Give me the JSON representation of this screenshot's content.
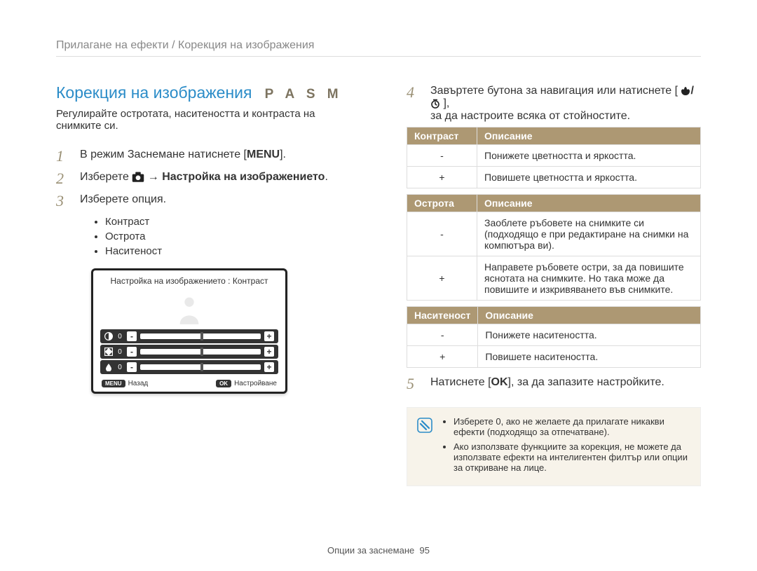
{
  "breadcrumb": "Прилагане на ефекти / Корекция на изображения",
  "title": "Корекция на изображения",
  "modes": "P A S M",
  "intro": "Регулирайте остротата, наситеността и контраста на снимките си.",
  "steps": {
    "s1_prefix": "В режим Заснемане натиснете [",
    "s1_key": "MENU",
    "s1_suffix": "].",
    "s2_prefix": "Изберете ",
    "s2_arrow": " → ",
    "s2_bold": "Настройка на изображението",
    "s2_suffix": ".",
    "s3": "Изберете опция.",
    "s4_a": "Завъртете бутона за навигация или натиснете [",
    "s4_b": "],",
    "s4_c": "за да настроите всяка от стойностите.",
    "s5_a": "Натиснете [",
    "s5_key": "OK",
    "s5_b": "], за да запазите настройките."
  },
  "bullets": [
    "Контраст",
    "Острота",
    "Наситеност"
  ],
  "lcd": {
    "title": "Настройка на изображението : Контраст",
    "back_key": "MENU",
    "back_label": "Назад",
    "set_key": "OK",
    "set_label": "Настройване",
    "rows": [
      {
        "val": "0"
      },
      {
        "val": "0"
      },
      {
        "val": "0"
      }
    ]
  },
  "tables": {
    "contrast": {
      "h1": "Контраст",
      "h2": "Описание",
      "rows": [
        {
          "k": "-",
          "v": "Понижете цветността и яркостта."
        },
        {
          "k": "+",
          "v": "Повишете цветността и яркостта."
        }
      ]
    },
    "sharpness": {
      "h1": "Острота",
      "h2": "Описание",
      "rows": [
        {
          "k": "-",
          "v": "Заоблете ръбовете на снимките си (подходящо е при редактиране на снимки на компютъра ви)."
        },
        {
          "k": "+",
          "v": "Направете ръбовете остри, за да повишите яснотата на снимките. Но така може да повишите и изкривяването във снимките."
        }
      ]
    },
    "saturation": {
      "h1": "Наситеност",
      "h2": "Описание",
      "rows": [
        {
          "k": "-",
          "v": "Понижете наситеността."
        },
        {
          "k": "+",
          "v": "Повишете наситеността."
        }
      ]
    }
  },
  "note": {
    "items": [
      "Изберете 0, ако не желаете да прилагате никакви ефекти (подходящо за отпечатване).",
      "Ако използвате функциите за корекция, не можете да използвате ефекти на интелигентен филтър или опции за откриване на лице."
    ]
  },
  "footer_label": "Опции за заснемане",
  "footer_page": "95"
}
